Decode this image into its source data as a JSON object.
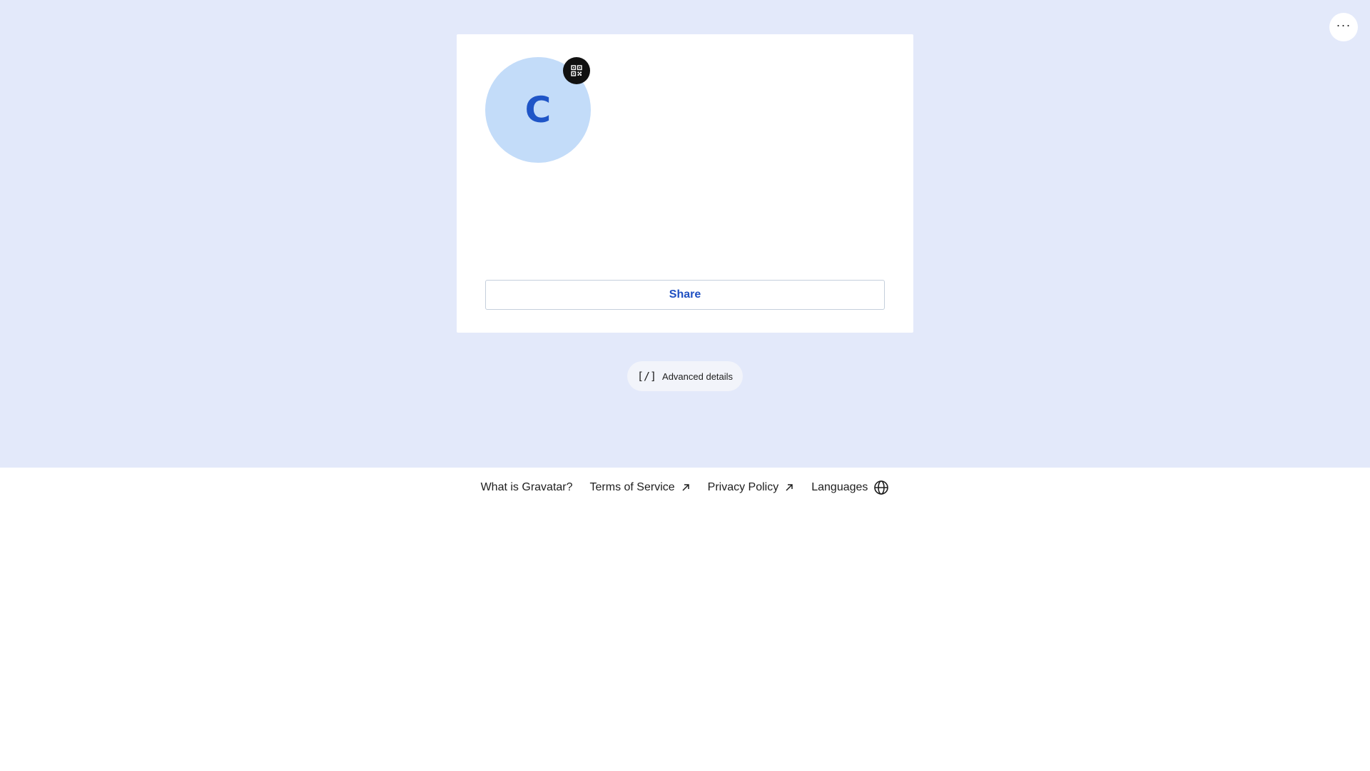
{
  "colors": {
    "page_background": "#e3e9fa",
    "card_background": "#ffffff",
    "avatar_background": "#c3dcf9",
    "avatar_letter": "#1f55c7",
    "accent": "#1f50c2"
  },
  "header": {
    "menu_icon": "more-horizontal-icon",
    "menu_symbol": "···"
  },
  "profile": {
    "avatar_letter": "C",
    "qr_icon": "qr-code-icon"
  },
  "card": {
    "share_label": "Share"
  },
  "advanced": {
    "icon_symbol": "[/]",
    "icon": "code-brackets-icon",
    "label": "Advanced details"
  },
  "footer": {
    "links": [
      {
        "label": "What is Gravatar?",
        "icon": ""
      },
      {
        "label": "Terms of Service",
        "icon": "external-arrow-icon"
      },
      {
        "label": "Privacy Policy",
        "icon": "external-arrow-icon"
      },
      {
        "label": "Languages",
        "icon": "globe-icon"
      }
    ]
  }
}
